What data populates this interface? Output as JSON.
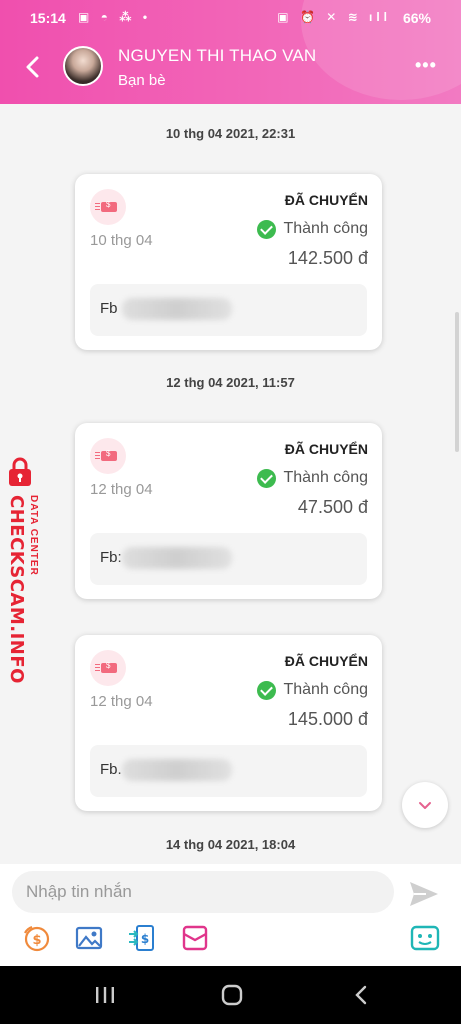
{
  "status_bar": {
    "time": "15:14",
    "left_icons": "▣ ◓ ⁂ •",
    "right_icons": "▣ ⏰ ✕ ≋ ıll",
    "battery": "66%"
  },
  "header": {
    "name": "NGUYEN THI THAO VAN",
    "subtitle": "Bạn bè"
  },
  "timestamps": [
    "10 thg 04 2021, 22:31",
    "12 thg 04 2021, 11:57",
    "14 thg 04 2021, 18:04"
  ],
  "cards": [
    {
      "date": "10 thg 04",
      "status_title": "ĐÃ CHUYỂN",
      "result": "Thành công",
      "amount": "142.500 đ",
      "note_label": "Fb"
    },
    {
      "date": "12 thg 04",
      "status_title": "ĐÃ CHUYỂN",
      "result": "Thành công",
      "amount": "47.500 đ",
      "note_label": "Fb:"
    },
    {
      "date": "12 thg 04",
      "status_title": "ĐÃ CHUYỂN",
      "result": "Thành công",
      "amount": "145.000 đ",
      "note_label": "Fb."
    }
  ],
  "watermark": {
    "main": "CHECKSCAM.INFO",
    "sub": "DATA CENTER"
  },
  "composer": {
    "placeholder": "Nhập tin nhắn"
  },
  "colors": {
    "header": "#f04fae",
    "success": "#3dbb4f",
    "watermark": "#e62434"
  }
}
